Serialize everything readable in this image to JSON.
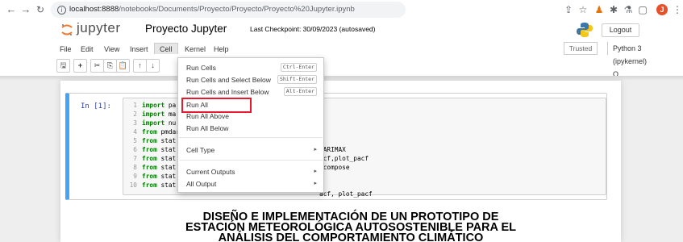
{
  "browser": {
    "url_host": "localhost:8888",
    "url_path": "/notebooks/Documents/Proyecto/Proyecto/Proyecto%20Jupyter.ipynb",
    "avatar_letter": "J",
    "colors": {
      "avatar": "#e8502a"
    }
  },
  "header": {
    "logo_text": "jupyter",
    "notebook_name": "Proyecto Jupyter",
    "checkpoint_label": "Last Checkpoint: 30/09/2023",
    "checkpoint_status": "(autosaved)",
    "logout_label": "Logout",
    "trusted_label": "Trusted",
    "kernel_label": "Python 3 (ipykernel)",
    "kernel_indicator": "O"
  },
  "menu": {
    "items": [
      "File",
      "Edit",
      "View",
      "Insert",
      "Cell",
      "Kernel",
      "Help"
    ],
    "active": "Cell"
  },
  "toolbar": {
    "buttons": [
      "save-icon",
      "plus-icon",
      "cut-icon",
      "copy-icon",
      "paste-icon",
      "arrow-up-icon",
      "arrow-down-icon"
    ]
  },
  "cell_menu": {
    "items": [
      {
        "label": "Run Cells",
        "shortcut": "Ctrl-Enter"
      },
      {
        "label": "Run Cells and Select Below",
        "shortcut": "Shift-Enter"
      },
      {
        "label": "Run Cells and Insert Below",
        "shortcut": "Alt-Enter"
      },
      {
        "label": "Run All"
      },
      {
        "label": "Run All Above"
      },
      {
        "label": "Run All Below"
      },
      {
        "label": "Cell Type"
      },
      {
        "label": "Current Outputs"
      },
      {
        "label": "All Output"
      }
    ],
    "highlighted": "Run All",
    "colors": {
      "highlight": "#e8192c"
    }
  },
  "code_cell": {
    "prompt": "In [1]:",
    "lines": [
      {
        "num": "1",
        "kw": "import",
        "rest": " pa"
      },
      {
        "num": "2",
        "kw": "import",
        "rest": " ma"
      },
      {
        "num": "3",
        "kw": "import",
        "rest": " nu"
      },
      {
        "num": "4",
        "kw": "from",
        "rest": " pmdar"
      },
      {
        "num": "5",
        "kw": "from",
        "rest": " stat"
      },
      {
        "num": "6",
        "kw": "from",
        "rest": " stat"
      },
      {
        "num": "7",
        "kw": "from",
        "rest": " stat"
      },
      {
        "num": "8",
        "kw": "from",
        "rest": " stat"
      },
      {
        "num": "9",
        "kw": "from",
        "rest": " stat"
      },
      {
        "num": "10",
        "kw": "from",
        "rest": " stat"
      }
    ],
    "visible_tails": {
      "line5": "SARIMAX",
      "line6": "acf,plot_pacf",
      "line7": "ecompose",
      "line10": "acf, plot_pacf"
    }
  },
  "markdown": {
    "title_line1": "DISEÑO E IMPLEMENTACIÓN DE UN PROTOTIPO DE",
    "title_line2": "ESTACIÓN METEOROLÓGICA AUTOSOSTENIBLE PARA EL",
    "title_line3": "ANÁLISIS DEL COMPORTAMIENTO CLIMÁTICO"
  }
}
